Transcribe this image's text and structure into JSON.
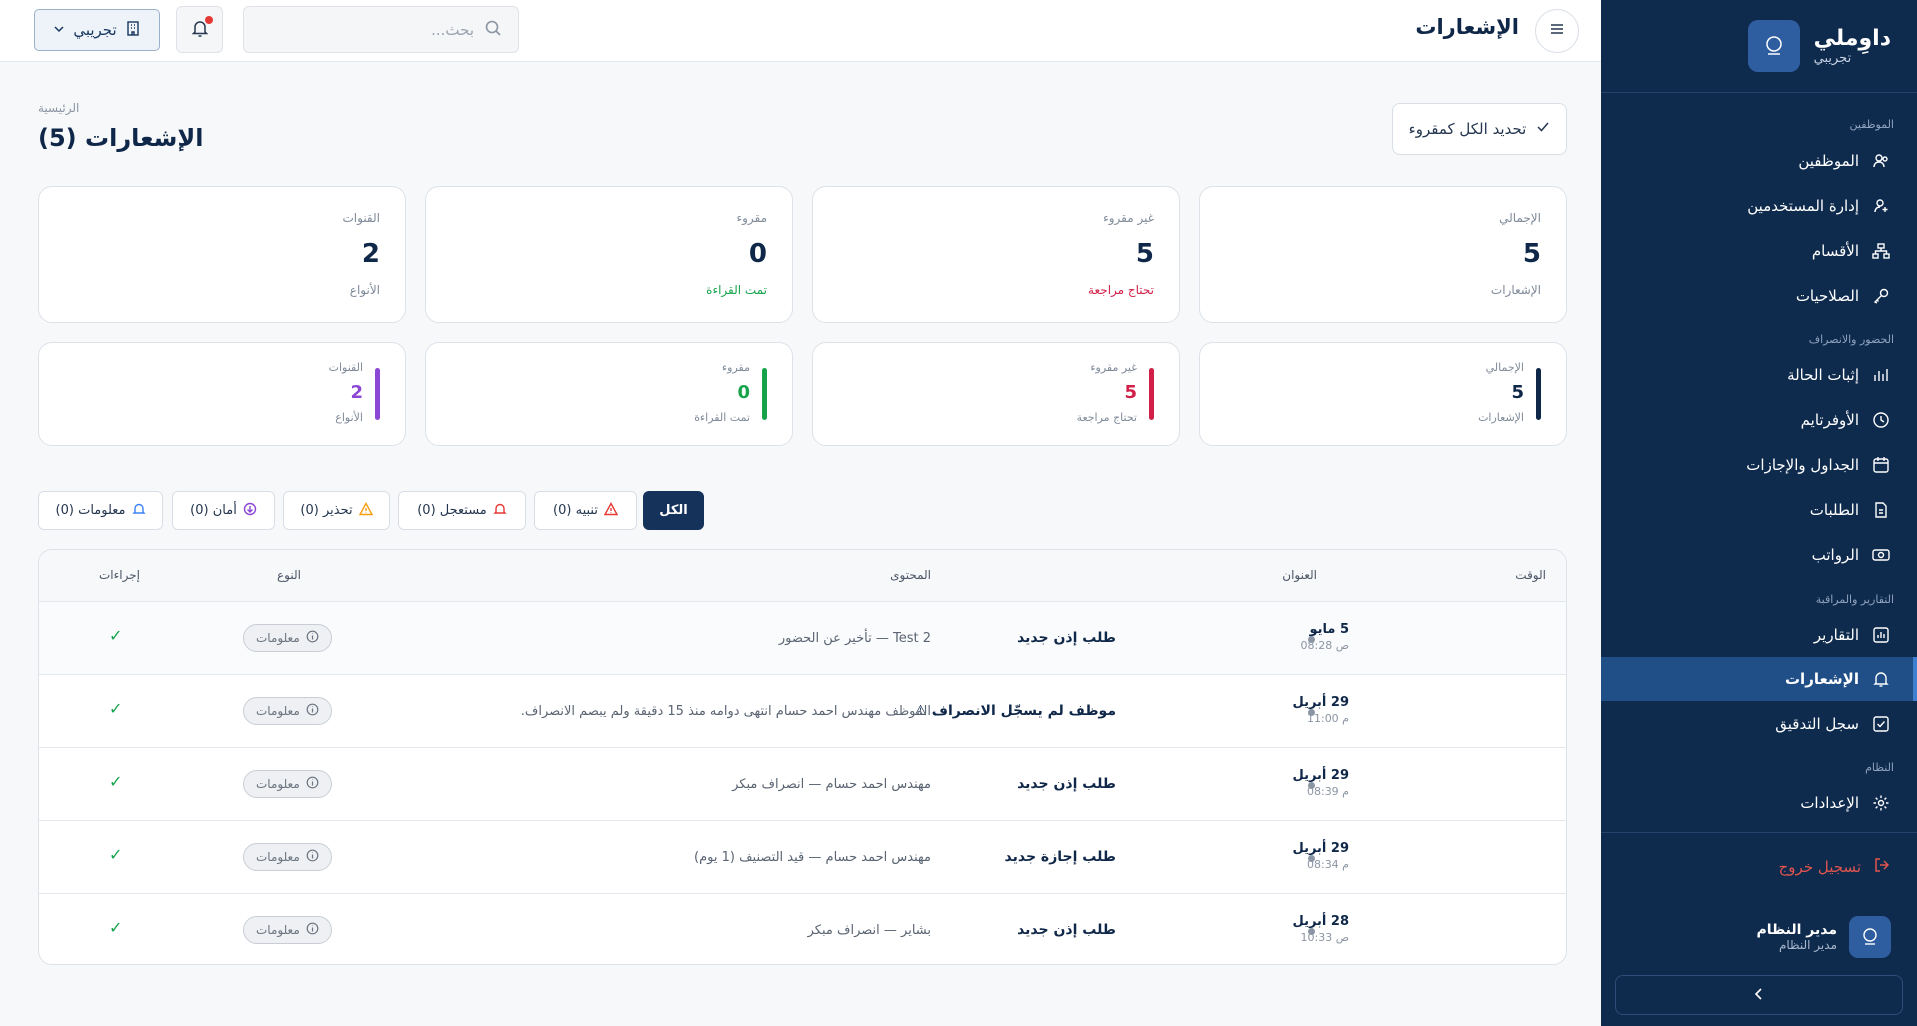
{
  "app": {
    "brand_title": "داوِملي",
    "brand_sub": "تجريبي",
    "logo_text": "داوملي",
    "page_header": "الإشعارات"
  },
  "topbar": {
    "search_placeholder": "بحث...",
    "org_label": "تجريبي"
  },
  "sidebar": {
    "sections": [
      {
        "title": "الموظفين",
        "items": [
          {
            "label": "الموظفين",
            "icon": "users-icon"
          },
          {
            "label": "إدارة المستخدمين",
            "icon": "user-plus-icon"
          },
          {
            "label": "الأقسام",
            "icon": "sitemap-icon"
          },
          {
            "label": "الصلاحيات",
            "icon": "key-icon"
          }
        ]
      },
      {
        "title": "الحضور والانصراف",
        "items": [
          {
            "label": "إثبات الحالة",
            "icon": "bar-chart-icon"
          },
          {
            "label": "الأوفرتايم",
            "icon": "clock-icon"
          },
          {
            "label": "الجداول والإجازات",
            "icon": "calendar-icon"
          },
          {
            "label": "الطلبات",
            "icon": "document-icon"
          },
          {
            "label": "الرواتب",
            "icon": "money-icon"
          }
        ]
      },
      {
        "title": "التقارير والمراقبة",
        "items": [
          {
            "label": "التقارير",
            "icon": "report-icon"
          },
          {
            "label": "الإشعارات",
            "icon": "bell-icon",
            "active": true
          },
          {
            "label": "سجل التدقيق",
            "icon": "audit-icon"
          }
        ]
      },
      {
        "title": "النظام",
        "items": [
          {
            "label": "الإعدادات",
            "icon": "gear-icon"
          }
        ]
      }
    ],
    "logout": "تسجيل خروج",
    "user_name": "مدير النظام",
    "user_role": "مدير النظام"
  },
  "main": {
    "breadcrumb": "الرئيسية",
    "title": "الإشعارات (5)",
    "mark_all_read": "تحديد الكل كمقروء",
    "stats": [
      {
        "label": "الإجمالي",
        "value": "5",
        "sub": "الإشعارات",
        "color": "#0f2748",
        "sub_color": "#7f8a99"
      },
      {
        "label": "غير مقروء",
        "value": "5",
        "sub": "تحتاج مراجعة",
        "color": "#0f2748",
        "sub_color": "#d11f47"
      },
      {
        "label": "مقروء",
        "value": "0",
        "sub": "تمت القراءة",
        "color": "#0f2748",
        "sub_color": "#16a34a"
      },
      {
        "label": "القنوات",
        "value": "2",
        "sub": "الأنواع",
        "color": "#0f2748",
        "sub_color": "#7f8a99"
      }
    ],
    "mini_stats": [
      {
        "label": "الإجمالي",
        "value": "5",
        "sub": "الإشعارات",
        "color": "#0f2748",
        "bar": "#0f2748"
      },
      {
        "label": "غير مقروء",
        "value": "5",
        "sub": "تحتاج مراجعة",
        "color": "#d11f47",
        "bar": "#d11f47"
      },
      {
        "label": "مقروء",
        "value": "0",
        "sub": "تمت القراءة",
        "color": "#16a34a",
        "bar": "#16a34a"
      },
      {
        "label": "القنوات",
        "value": "2",
        "sub": "الأنواع",
        "color": "#8b46d6",
        "bar": "#8b46d6"
      }
    ],
    "filters": [
      {
        "label": "الكل",
        "icon": "",
        "active": true
      },
      {
        "label": "تنبيه (0)",
        "icon": "alert-icon",
        "color": "#e53935"
      },
      {
        "label": "مستعجل (0)",
        "icon": "bell-icon",
        "color": "#e53935"
      },
      {
        "label": "تحذير (0)",
        "icon": "warning-icon",
        "color": "#f59e0b"
      },
      {
        "label": "أمان (0)",
        "icon": "shield-icon",
        "color": "#8b46d6"
      },
      {
        "label": "معلومات (0)",
        "icon": "bell-icon",
        "color": "#3b82f6"
      }
    ],
    "table": {
      "columns": [
        "الوقت",
        "العنوان",
        "المحتوى",
        "النوع",
        "إجراءات"
      ],
      "rows": [
        {
          "date": "5 مايو",
          "time": "ص 08:28",
          "title": "طلب إذن جديد",
          "content": "Test 2 — تأخير عن الحضور",
          "type": "معلومات"
        },
        {
          "date": "29 أبريل",
          "time": "م 11:00",
          "title": "موظف لم يسجّل الانصراف ⚠",
          "content": "الموظف مهندس احمد حسام انتهى دوامه منذ 15 دقيقة ولم يبصم الانصراف.",
          "type": "معلومات"
        },
        {
          "date": "29 أبريل",
          "time": "م 08:39",
          "title": "طلب إذن جديد",
          "content": "مهندس احمد حسام — انصراف مبكر",
          "type": "معلومات"
        },
        {
          "date": "29 أبريل",
          "time": "م 08:34",
          "title": "طلب إجازة جديد",
          "content": "مهندس احمد حسام — قيد التصنيف (1 يوم)",
          "type": "معلومات"
        },
        {
          "date": "28 أبريل",
          "time": "ص 10:33",
          "title": "طلب إذن جديد",
          "content": "بشاير — انصراف مبكر",
          "type": "معلومات"
        }
      ]
    }
  }
}
